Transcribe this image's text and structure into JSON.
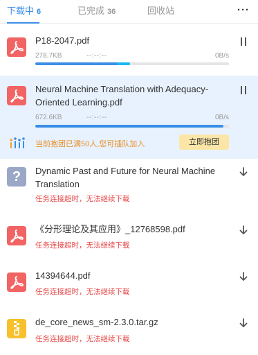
{
  "tabs": [
    {
      "label": "下载中",
      "count": "6"
    },
    {
      "label": "已完成",
      "count": "36"
    },
    {
      "label": "回收站",
      "count": ""
    }
  ],
  "more_label": "···",
  "colors": {
    "accent": "#3a8ee6",
    "error": "#e64646",
    "promo": "#e88f29",
    "pdf_icon": "#f26464"
  },
  "items": [
    {
      "name": "P18-2047.pdf",
      "icon": "pdf-icon",
      "size": "278.7KB",
      "eta": "--:--:--",
      "speed": "0B/s",
      "progress": 0.49,
      "action": "pause-icon"
    },
    {
      "name": "Neural Machine Translation with Adequacy-Oriented Learning.pdf",
      "icon": "pdf-icon",
      "size": "672.6KB",
      "eta": "--:--:--",
      "speed": "0B/s",
      "progress": 0.97,
      "action": "pause-icon",
      "promo_text": "当前抱团已满50人,您可插队加入",
      "promo_button": "立即抱团"
    },
    {
      "name": "Dynamic Past and Future for Neural Machine Translation",
      "icon": "unknown-file-icon",
      "error": "任务连接超时，无法继续下载",
      "action": "download-arrow-icon"
    },
    {
      "name": "《分形理论及其应用》_12768598.pdf",
      "icon": "pdf-icon",
      "error": "任务连接超时，无法继续下载",
      "action": "download-arrow-icon"
    },
    {
      "name": "14394644.pdf",
      "icon": "pdf-icon",
      "error": "任务连接超时，无法继续下载",
      "action": "download-arrow-icon"
    },
    {
      "name": "de_core_news_sm-2.3.0.tar.gz",
      "icon": "archive-icon",
      "error": "任务连接超时，无法继续下载",
      "action": "download-arrow-icon"
    }
  ]
}
